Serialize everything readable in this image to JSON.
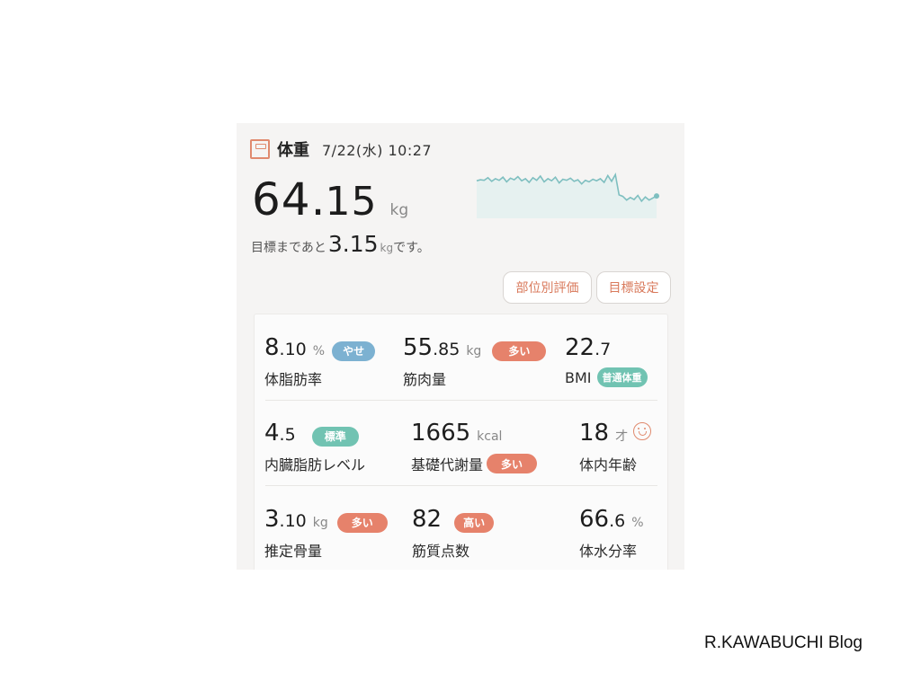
{
  "header": {
    "title": "体重",
    "datetime": "7/22(水) 10:27",
    "icon": "scale-icon"
  },
  "weight": {
    "int": "64",
    "dot": ".",
    "dec": "15",
    "unit": "kg"
  },
  "goal": {
    "prefix": "目標まであと",
    "value": "3.15",
    "unit": "kg",
    "suffix": "です。"
  },
  "buttons": {
    "region": "部位別評価",
    "goal_setting": "目標設定"
  },
  "trend": [
    0.72,
    0.74,
    0.73,
    0.78,
    0.71,
    0.76,
    0.73,
    0.79,
    0.7,
    0.77,
    0.74,
    0.8,
    0.72,
    0.76,
    0.69,
    0.78,
    0.73,
    0.81,
    0.7,
    0.76,
    0.72,
    0.79,
    0.68,
    0.75,
    0.73,
    0.77,
    0.71,
    0.74,
    0.66,
    0.73,
    0.7,
    0.75,
    0.72,
    0.76,
    0.69,
    0.82,
    0.71,
    0.84,
    0.45,
    0.42,
    0.35,
    0.4,
    0.36,
    0.44,
    0.33,
    0.41,
    0.35,
    0.39,
    0.43
  ],
  "metrics": [
    {
      "id": "body-fat",
      "int": "8",
      "dec": ".10",
      "unit": "%",
      "badge": "やせ",
      "badge_color": "#7cb1d1",
      "label": "体脂肪率"
    },
    {
      "id": "muscle",
      "int": "55",
      "dec": ".85",
      "unit": "kg",
      "badge": "多い",
      "badge_color": "#e6826b",
      "label": "筋肉量"
    },
    {
      "id": "bmi",
      "int": "22",
      "dec": ".7",
      "unit": "",
      "badge": "普通体重",
      "badge_color": "#71c3b2",
      "label": "BMI"
    },
    {
      "id": "visceral",
      "int": "4",
      "dec": ".5",
      "unit": "",
      "badge": "標準",
      "badge_color": "#71c3b2",
      "label": "内臓脂肪レベル"
    },
    {
      "id": "bmr",
      "int": "1665",
      "dec": "",
      "unit": "kcal",
      "badge": "多い",
      "badge_color": "#e6826b",
      "label": "基礎代謝量"
    },
    {
      "id": "body-age",
      "int": "18",
      "dec": "",
      "unit": "才",
      "badge": "",
      "badge_color": "",
      "label": "体内年齢"
    },
    {
      "id": "bone",
      "int": "3",
      "dec": ".10",
      "unit": "kg",
      "badge": "多い",
      "badge_color": "#e6826b",
      "label": "推定骨量"
    },
    {
      "id": "muscle-quality",
      "int": "82",
      "dec": "",
      "unit": "",
      "badge": "高い",
      "badge_color": "#e6826b",
      "label": "筋質点数"
    },
    {
      "id": "water",
      "int": "66",
      "dec": ".6",
      "unit": "%",
      "badge": "",
      "badge_color": "",
      "label": "体水分率"
    }
  ],
  "watermark": "R.KAWABUCHI Blog",
  "colors": {
    "accent": "#e08a6e",
    "trend_line": "#7fbfc0",
    "trend_fill": "#e6f1f0"
  }
}
